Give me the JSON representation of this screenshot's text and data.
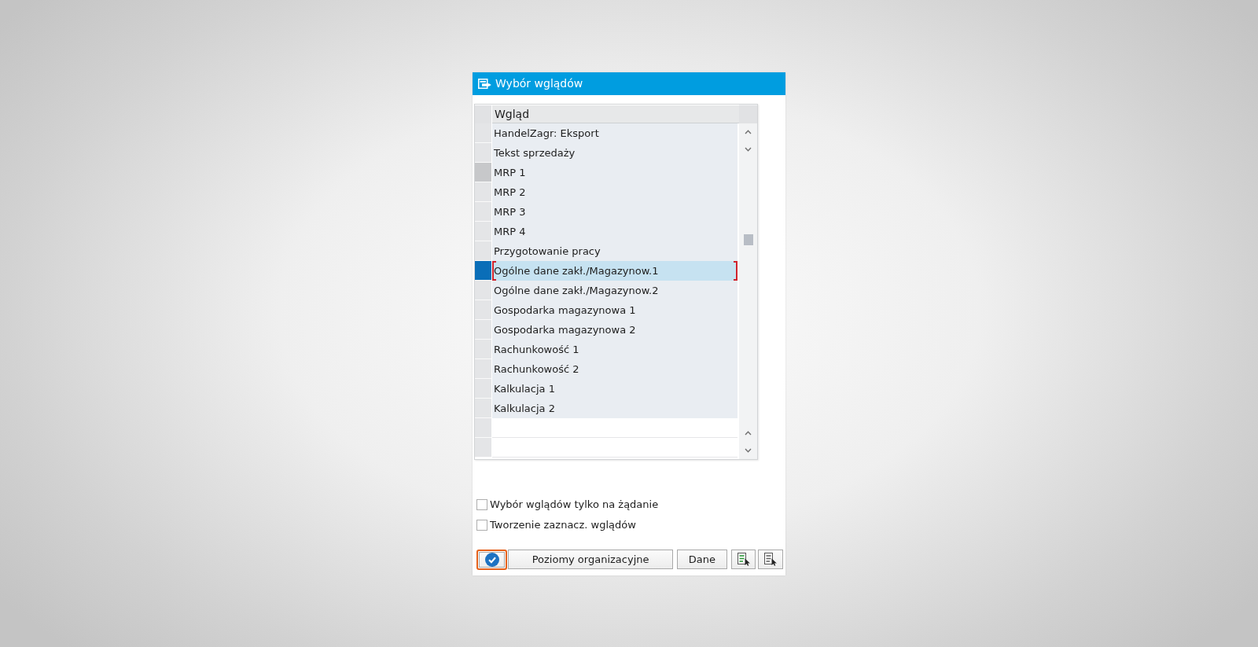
{
  "window": {
    "title": "Wybór wglądów"
  },
  "table": {
    "columns": [
      "Wgląd"
    ],
    "rows": [
      {
        "kind": "view",
        "label": "HandelZagr: Eksport",
        "selected": false,
        "highlighted": false,
        "focused": false
      },
      {
        "kind": "view",
        "label": "Tekst sprzedaży",
        "selected": false,
        "highlighted": false,
        "focused": false
      },
      {
        "kind": "view",
        "label": "MRP 1",
        "selected": false,
        "highlighted": true,
        "focused": false
      },
      {
        "kind": "view",
        "label": "MRP 2",
        "selected": false,
        "highlighted": false,
        "focused": false
      },
      {
        "kind": "view",
        "label": "MRP 3",
        "selected": false,
        "highlighted": false,
        "focused": false
      },
      {
        "kind": "view",
        "label": "MRP 4",
        "selected": false,
        "highlighted": false,
        "focused": false
      },
      {
        "kind": "view",
        "label": "Przygotowanie pracy",
        "selected": false,
        "highlighted": false,
        "focused": false
      },
      {
        "kind": "view",
        "label": "Ogólne dane zakł./Magazynow.1",
        "selected": true,
        "highlighted": false,
        "focused": true
      },
      {
        "kind": "view",
        "label": "Ogólne dane zakł./Magazynow.2",
        "selected": false,
        "highlighted": false,
        "focused": false
      },
      {
        "kind": "view",
        "label": "Gospodarka magazynowa 1",
        "selected": false,
        "highlighted": false,
        "focused": false
      },
      {
        "kind": "view",
        "label": "Gospodarka magazynowa 2",
        "selected": false,
        "highlighted": false,
        "focused": false
      },
      {
        "kind": "view",
        "label": "Rachunkowość 1",
        "selected": false,
        "highlighted": false,
        "focused": false
      },
      {
        "kind": "view",
        "label": "Rachunkowość 2",
        "selected": false,
        "highlighted": false,
        "focused": false
      },
      {
        "kind": "view",
        "label": "Kalkulacja 1",
        "selected": false,
        "highlighted": false,
        "focused": false
      },
      {
        "kind": "view",
        "label": "Kalkulacja 2",
        "selected": false,
        "highlighted": false,
        "focused": false
      },
      {
        "kind": "empty",
        "selected": false,
        "highlighted": false,
        "focused": false
      },
      {
        "kind": "empty",
        "selected": false,
        "highlighted": false,
        "focused": false
      }
    ]
  },
  "options": [
    {
      "label": "Wybór wglądów tylko na żądanie",
      "checked": false
    },
    {
      "label": "Tworzenie zaznacz. wglądów",
      "checked": false
    }
  ],
  "buttons": [
    {
      "kind": "check",
      "focused": true
    },
    {
      "kind": "label",
      "label": "Poziomy organizacyjne",
      "focused": false
    },
    {
      "kind": "label",
      "label": "Dane",
      "focused": false
    },
    {
      "kind": "mark",
      "focused": false
    },
    {
      "kind": "unmark",
      "focused": false
    }
  ]
}
